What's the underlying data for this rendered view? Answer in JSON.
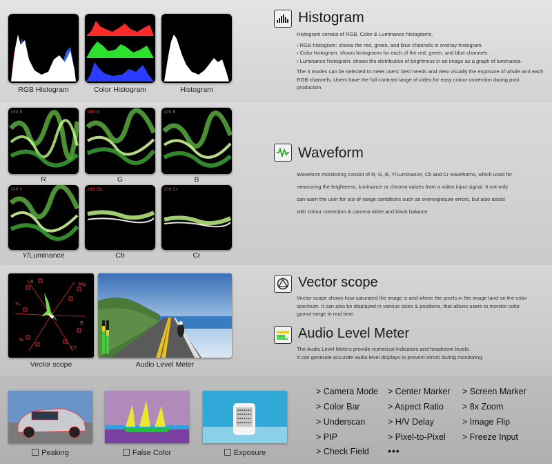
{
  "histogram": {
    "title": "Histogram",
    "intro": "Histogram consist of RGB, Color & Luminance histograms.",
    "bullets": [
      "RGB histogram: shows the red, green, and blue channels in overlay histogram.",
      "Color histogram: shows histograms for each of the red, green, and blue channels.",
      "Luminance histogram: shows the distribution of brightness in an image as a graph of luminance."
    ],
    "outro_1": "The 3 modes can be selected to meet users' best needs and view visually the exposure of whole and each",
    "outro_2": "RGB channels. Users have the full contrast range of video for easy colour correction during post production.",
    "captions": [
      "RGB Histogram",
      "Color Histogram",
      "Histogram"
    ]
  },
  "waveform": {
    "title": "Waveform",
    "lines": [
      "Waveform monitoring consist of R, G, B, Y/Luminance, Cb and Cr waveforms, which used for",
      "measuring the brightness, luminance or chroma values from a video input signal. It not only",
      "can warn the user for out-of-range conditions such as overexposure errors, but also assist",
      "with colour correction & camera white and black balance."
    ],
    "captions": [
      "R",
      "G",
      "B",
      "Y/Luminance",
      "Cb",
      "Cr"
    ],
    "scale_labels": [
      "100 R",
      "100 G",
      "100 B",
      "100 Y",
      "100 Cb",
      "100 Cr"
    ]
  },
  "vector": {
    "title": "Vector scope",
    "lines": [
      "Vector scope shows how saturated the image is and where the pixels in the image land on the color",
      "spectrum. It can also be displayed in various sizes & positions, that allows users to monitor color",
      "gamut range in real time."
    ],
    "caption": "Vector scope",
    "labels": [
      "R",
      "Mg",
      "YL",
      "B",
      "G",
      "CY"
    ]
  },
  "audio": {
    "title": "Audio Level Meter",
    "lines": [
      "The Audio Level Meters provide numerical indicators and headroom levels.",
      "It can generate accurate audio level displays to prevent errors during monitoring."
    ],
    "caption": "Audio Level Meter"
  },
  "features": {
    "captions": [
      "Peaking",
      "False Color",
      "Exposure"
    ],
    "col1": [
      "> Camera Mode",
      "> Color Bar",
      "> Underscan",
      "> PIP",
      "> Check Field"
    ],
    "col2": [
      "> Center Marker",
      "> Aspect Ratio",
      "> H/V Delay",
      "> Pixel-to-Pixel"
    ],
    "col3": [
      "> Screen Marker",
      "> 8x Zoom",
      "> Image Flip",
      "> Freeze Input"
    ],
    "more": "•••"
  }
}
